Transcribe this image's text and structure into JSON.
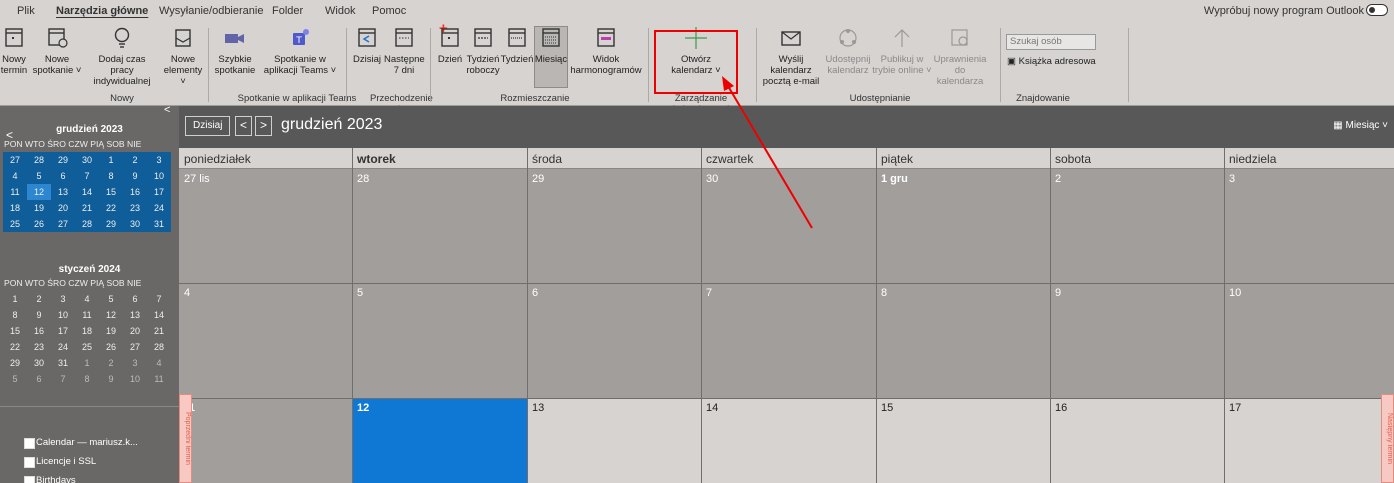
{
  "menu": {
    "items": [
      "Plik",
      "Narzędzia główne",
      "Wysyłanie/odbieranie",
      "Folder",
      "Widok",
      "Pomoc"
    ],
    "try_outlook": "Wypróbuj nowy program Outlook"
  },
  "ribbon": {
    "new_appt": [
      "Nowy",
      "termin"
    ],
    "new_meeting": [
      "Nowe",
      "spotkanie ˅"
    ],
    "work_time": [
      "Dodaj czas pracy",
      "indywidualnej"
    ],
    "new_items": [
      "Nowe",
      "elementy ˅"
    ],
    "group_new": "Nowy",
    "quick_meet": [
      "Szybkie",
      "spotkanie"
    ],
    "teams_meet": [
      "Spotkanie w",
      "aplikacji Teams ˅"
    ],
    "group_teams": "Spotkanie w aplikacji Teams",
    "today": [
      "Dzisiaj",
      ""
    ],
    "next7": [
      "Następne",
      "7 dni"
    ],
    "group_goto": "Przechodzenie do",
    "day": [
      "Dzień",
      ""
    ],
    "work_week": [
      "Tydzień",
      "roboczy"
    ],
    "week": [
      "Tydzień",
      ""
    ],
    "month": [
      "Miesiąc",
      ""
    ],
    "schedule": [
      "Widok",
      "harmonogramów"
    ],
    "group_arrange": "Rozmieszczanie",
    "open_cal": [
      "Otwórz",
      "kalendarz ˅"
    ],
    "group_manage": "Zarządzanie kalendarzami",
    "email_cal": [
      "Wyślij kalendarz",
      "pocztą e-mail"
    ],
    "share_cal": [
      "Udostępnij",
      "kalendarz"
    ],
    "publish": [
      "Publikuj w",
      "trybie online ˅"
    ],
    "perms": [
      "Uprawnienia",
      "do kalendarza"
    ],
    "group_share": "Udostępnianie",
    "search_people": "Szukaj osób",
    "address_book": "Książka adresowa",
    "group_find": "Znajdowanie"
  },
  "calendar": {
    "today_btn": "Dzisiaj",
    "prev": "<",
    "next": ">",
    "title": "grudzień 2023",
    "view": "Miesiąc ˅",
    "days": [
      "poniedziałek",
      "wtorek",
      "środa",
      "czwartek",
      "piątek",
      "sobota",
      "niedziela"
    ],
    "weeks": [
      [
        "27 lis",
        "28",
        "29",
        "30",
        "1 gru",
        "2",
        "3"
      ],
      [
        "4",
        "5",
        "6",
        "7",
        "8",
        "9",
        "10"
      ],
      [
        "11",
        "12",
        "13",
        "14",
        "15",
        "16",
        "17"
      ]
    ],
    "prev_tab": "Poprzedni termin",
    "next_tab": "Następny termin"
  },
  "mini": {
    "dow": "PON WTO ŚRO CZW PIĄ SOB NIE",
    "dec_title": "grudzień 2023",
    "dec_days": [
      "27",
      "28",
      "29",
      "30",
      "1",
      "2",
      "3",
      "4",
      "5",
      "6",
      "7",
      "8",
      "9",
      "10",
      "11",
      "12",
      "13",
      "14",
      "15",
      "16",
      "17",
      "18",
      "19",
      "20",
      "21",
      "22",
      "23",
      "24",
      "25",
      "26",
      "27",
      "28",
      "29",
      "30",
      "31"
    ],
    "jan_title": "styczeń 2024",
    "jan_days": [
      "1",
      "2",
      "3",
      "4",
      "5",
      "6",
      "7",
      "8",
      "9",
      "10",
      "11",
      "12",
      "13",
      "14",
      "15",
      "16",
      "17",
      "18",
      "19",
      "20",
      "21",
      "22",
      "23",
      "24",
      "25",
      "26",
      "27",
      "28",
      "29",
      "30",
      "31",
      "1",
      "2",
      "3",
      "4",
      "5",
      "6",
      "7",
      "8",
      "9",
      "10",
      "11"
    ]
  },
  "calendars": [
    "Calendar — mariusz.k...",
    "Licencje i SSL",
    "Birthdays"
  ],
  "colors": {
    "highlight": "#e00000",
    "today": "#0f78d4",
    "mini_selected": "#0f5d99"
  }
}
